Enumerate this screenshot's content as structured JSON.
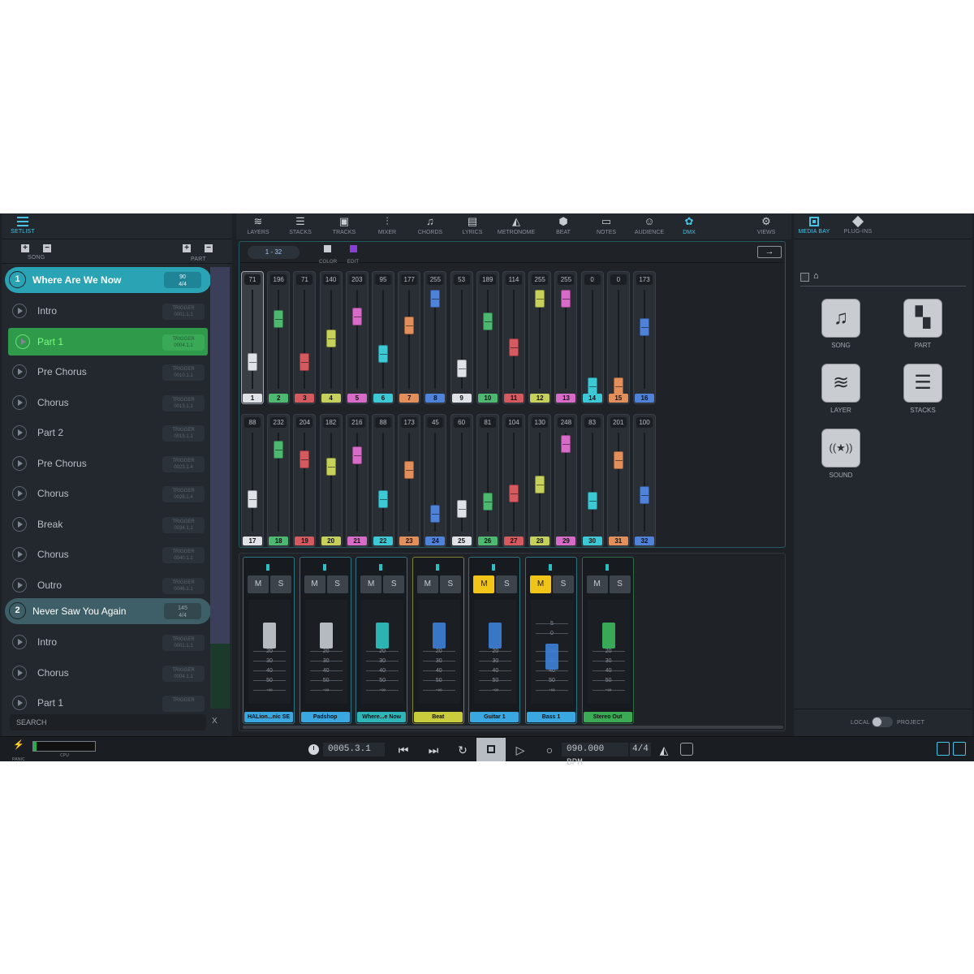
{
  "left": {
    "setlist_label": "SETLIST",
    "song_label": "SONG",
    "part_label": "PART",
    "add": "+",
    "remove": "−",
    "songs": [
      {
        "num": "1",
        "name": "Where Are We Now",
        "bpm": "90",
        "sig": "4/4"
      },
      {
        "num": "2",
        "name": "Never Saw You Again",
        "bpm": "145",
        "sig": "4/4"
      }
    ],
    "parts_song1": [
      {
        "name": "Intro",
        "trigger": "TRIGGER",
        "pos": "0001.1.1"
      },
      {
        "name": "Part 1",
        "trigger": "TRIGGER",
        "pos": "0004.1.1"
      },
      {
        "name": "Pre Chorus",
        "trigger": "TRIGGER",
        "pos": "0010.1.1"
      },
      {
        "name": "Chorus",
        "trigger": "TRIGGER",
        "pos": "0013.1.1"
      },
      {
        "name": "Part 2",
        "trigger": "TRIGGER",
        "pos": "0019.1.1"
      },
      {
        "name": "Pre Chorus",
        "trigger": "TRIGGER",
        "pos": "0023.1.4"
      },
      {
        "name": "Chorus",
        "trigger": "TRIGGER",
        "pos": "0028.1.4"
      },
      {
        "name": "Break",
        "trigger": "TRIGGER",
        "pos": "0034.1.1"
      },
      {
        "name": "Chorus",
        "trigger": "TRIGGER",
        "pos": "0040.1.1"
      },
      {
        "name": "Outro",
        "trigger": "TRIGGER",
        "pos": "0046.1.1"
      }
    ],
    "parts_song2": [
      {
        "name": "Intro",
        "trigger": "TRIGGER",
        "pos": "0001.1.1"
      },
      {
        "name": "Chorus",
        "trigger": "TRIGGER",
        "pos": "0004.1.1"
      },
      {
        "name": "Part 1",
        "trigger": "TRIGGER",
        "pos": ""
      }
    ],
    "search_placeholder": "SEARCH",
    "search_clear": "X"
  },
  "nav": {
    "items": [
      "LAYERS",
      "STACKS",
      "TRACKS",
      "MIXER",
      "CHORDS",
      "LYRICS",
      "METRONOME",
      "BEAT",
      "NOTES",
      "AUDIENCE",
      "DMX"
    ],
    "views": "VIEWS",
    "active": "DMX"
  },
  "dmx": {
    "range": "1 - 32",
    "color_label": "COLOR",
    "edit_label": "EDIT",
    "arrow": "→",
    "channels": [
      {
        "ch": "1",
        "value": 71,
        "color": "#dfe3e8"
      },
      {
        "ch": "2",
        "value": 196,
        "color": "#4cb870"
      },
      {
        "ch": "3",
        "value": 71,
        "color": "#d45a5f"
      },
      {
        "ch": "4",
        "value": 140,
        "color": "#c5d15a"
      },
      {
        "ch": "5",
        "value": 203,
        "color": "#d96bc8"
      },
      {
        "ch": "6",
        "value": 95,
        "color": "#3dc8d6"
      },
      {
        "ch": "7",
        "value": 177,
        "color": "#e38f5c"
      },
      {
        "ch": "8",
        "value": 255,
        "color": "#4f82d9"
      },
      {
        "ch": "9",
        "value": 53,
        "color": "#dfe3e8"
      },
      {
        "ch": "10",
        "value": 189,
        "color": "#4cb870"
      },
      {
        "ch": "11",
        "value": 114,
        "color": "#d45a5f"
      },
      {
        "ch": "12",
        "value": 255,
        "color": "#c5d15a"
      },
      {
        "ch": "13",
        "value": 255,
        "color": "#d96bc8"
      },
      {
        "ch": "14",
        "value": 0,
        "color": "#3dc8d6"
      },
      {
        "ch": "15",
        "value": 0,
        "color": "#e38f5c"
      },
      {
        "ch": "16",
        "value": 173,
        "color": "#4f82d9"
      },
      {
        "ch": "17",
        "value": 88,
        "color": "#dfe3e8"
      },
      {
        "ch": "18",
        "value": 232,
        "color": "#4cb870"
      },
      {
        "ch": "19",
        "value": 204,
        "color": "#d45a5f"
      },
      {
        "ch": "20",
        "value": 182,
        "color": "#c5d15a"
      },
      {
        "ch": "21",
        "value": 216,
        "color": "#d96bc8"
      },
      {
        "ch": "22",
        "value": 88,
        "color": "#3dc8d6"
      },
      {
        "ch": "23",
        "value": 173,
        "color": "#e38f5c"
      },
      {
        "ch": "24",
        "value": 45,
        "color": "#4f82d9"
      },
      {
        "ch": "25",
        "value": 60,
        "color": "#dfe3e8"
      },
      {
        "ch": "26",
        "value": 81,
        "color": "#4cb870"
      },
      {
        "ch": "27",
        "value": 104,
        "color": "#d45a5f"
      },
      {
        "ch": "28",
        "value": 130,
        "color": "#c5d15a"
      },
      {
        "ch": "29",
        "value": 248,
        "color": "#d96bc8"
      },
      {
        "ch": "30",
        "value": 83,
        "color": "#3dc8d6"
      },
      {
        "ch": "31",
        "value": 201,
        "color": "#e38f5c"
      },
      {
        "ch": "32",
        "value": 100,
        "color": "#4f82d9"
      }
    ]
  },
  "mixer": {
    "mute": "M",
    "solo": "S",
    "scale_marks": [
      "5",
      "0",
      "20",
      "30",
      "40",
      "50",
      "-∞"
    ],
    "strips": [
      {
        "name": "HALion...nic SE",
        "color": "#3aa7e0",
        "mute_on": false
      },
      {
        "name": "Padshop",
        "color": "#3aa7e0",
        "mute_on": false
      },
      {
        "name": "Where...e Now",
        "color": "#2fb4b8",
        "mute_on": false
      },
      {
        "name": "Beat",
        "color": "#c9cc3c",
        "mute_on": false
      },
      {
        "name": "Guitar 1",
        "color": "#3aa7e0",
        "mute_on": true
      },
      {
        "name": "Bass 1",
        "color": "#3aa7e0",
        "mute_on": true
      },
      {
        "name": "Stereo Out",
        "color": "#3caa55",
        "mute_on": false
      }
    ],
    "fader_colors": [
      "#c6cbd2",
      "#c6cbd2",
      "#2fc4c4",
      "#3d7fd6",
      "#3d7fd6",
      "#3d7fd6",
      "#3cb85c"
    ]
  },
  "right": {
    "tabs": [
      "MEDIA BAY",
      "PLUG-INS"
    ],
    "items": [
      {
        "label": "SONG",
        "icon": "music-note-icon",
        "glyph": "♫"
      },
      {
        "label": "PART",
        "icon": "part-grid-icon",
        "glyph": "▚"
      },
      {
        "label": "LAYER",
        "icon": "layers-icon",
        "glyph": "≋"
      },
      {
        "label": "STACKS",
        "icon": "stacks-icon",
        "glyph": "☰"
      },
      {
        "label": "SOUND",
        "icon": "sound-icon",
        "glyph": "((★))"
      }
    ],
    "home": "⌂",
    "local": "LOCAL",
    "project": "PROJECT"
  },
  "transport": {
    "panic": "PANIC",
    "cpu": "CPU",
    "cpu_load": 0.05,
    "position": "0005.3.1",
    "tempo": "090.000",
    "bpm_label": "BPM",
    "signature": "4/4"
  }
}
